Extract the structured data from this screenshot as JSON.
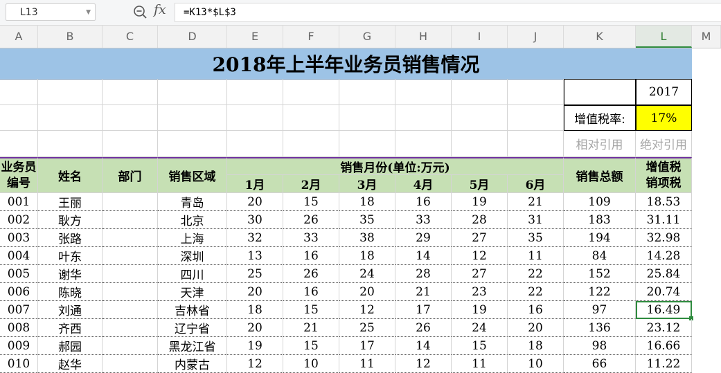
{
  "formula_bar": {
    "cell_ref": "L13",
    "fx_label": "fx",
    "formula": "=K13*$L$3"
  },
  "columns": [
    "A",
    "B",
    "C",
    "D",
    "E",
    "F",
    "G",
    "H",
    "I",
    "J",
    "K",
    "L",
    "M"
  ],
  "active_column": "L",
  "sheet": {
    "title": "2018年上半年业务员销售情况",
    "year_value": "2017",
    "tax_rate_label": "增值税率:",
    "tax_rate_value": "17%",
    "relative_ref_label": "相对引用",
    "absolute_ref_label": "绝对引用",
    "headers": {
      "id_line1": "业务员",
      "id_line2": "编号",
      "name": "姓名",
      "dept": "部门",
      "region": "销售区域",
      "months_group": "销售月份(单位:万元)",
      "months": [
        "1月",
        "2月",
        "3月",
        "4月",
        "5月",
        "6月"
      ],
      "total": "销售总额",
      "tax_line1": "增值税",
      "tax_line2": "销项税"
    },
    "rows": [
      {
        "id": "001",
        "name": "王丽",
        "dept": "",
        "region": "青岛",
        "m": [
          "20",
          "15",
          "18",
          "16",
          "19",
          "21"
        ],
        "total": "109",
        "tax": "18.53"
      },
      {
        "id": "002",
        "name": "耿方",
        "dept": "",
        "region": "北京",
        "m": [
          "30",
          "26",
          "35",
          "33",
          "28",
          "31"
        ],
        "total": "183",
        "tax": "31.11"
      },
      {
        "id": "003",
        "name": "张路",
        "dept": "",
        "region": "上海",
        "m": [
          "32",
          "33",
          "38",
          "29",
          "27",
          "35"
        ],
        "total": "194",
        "tax": "32.98"
      },
      {
        "id": "004",
        "name": "叶东",
        "dept": "",
        "region": "深圳",
        "m": [
          "13",
          "16",
          "18",
          "14",
          "12",
          "11"
        ],
        "total": "84",
        "tax": "14.28"
      },
      {
        "id": "005",
        "name": "谢华",
        "dept": "",
        "region": "四川",
        "m": [
          "25",
          "26",
          "24",
          "28",
          "27",
          "22"
        ],
        "total": "152",
        "tax": "25.84"
      },
      {
        "id": "006",
        "name": "陈晓",
        "dept": "",
        "region": "天津",
        "m": [
          "20",
          "16",
          "20",
          "21",
          "23",
          "22"
        ],
        "total": "122",
        "tax": "20.74"
      },
      {
        "id": "007",
        "name": "刘通",
        "dept": "",
        "region": "吉林省",
        "m": [
          "18",
          "15",
          "12",
          "17",
          "19",
          "16"
        ],
        "total": "97",
        "tax": "16.49"
      },
      {
        "id": "008",
        "name": "齐西",
        "dept": "",
        "region": "辽宁省",
        "m": [
          "20",
          "21",
          "25",
          "26",
          "24",
          "20"
        ],
        "total": "136",
        "tax": "23.12"
      },
      {
        "id": "009",
        "name": "郝园",
        "dept": "",
        "region": "黑龙江省",
        "m": [
          "19",
          "15",
          "17",
          "14",
          "15",
          "18"
        ],
        "total": "98",
        "tax": "16.66"
      },
      {
        "id": "010",
        "name": "赵华",
        "dept": "",
        "region": "内蒙古",
        "m": [
          "12",
          "10",
          "11",
          "12",
          "11",
          "10"
        ],
        "total": "66",
        "tax": "11.22"
      }
    ]
  }
}
